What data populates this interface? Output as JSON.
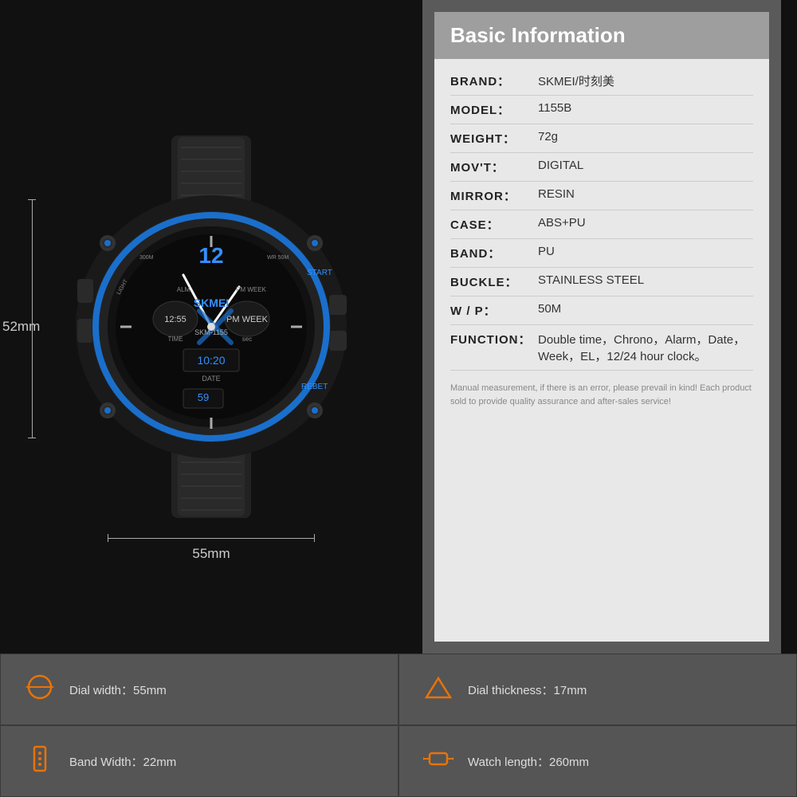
{
  "page": {
    "bg_color": "#111111"
  },
  "header": {
    "title": "Basic Information"
  },
  "specs": [
    {
      "key": "BRAND：",
      "val": "SKMEI/时刻美"
    },
    {
      "key": "MODEL：",
      "val": "1155B"
    },
    {
      "key": "WEIGHT：",
      "val": "72g"
    },
    {
      "key": "MOV'T：",
      "val": "DIGITAL"
    },
    {
      "key": "MIRROR：",
      "val": "RESIN"
    },
    {
      "key": "CASE：",
      "val": "ABS+PU"
    },
    {
      "key": "BAND：",
      "val": "PU"
    },
    {
      "key": "BUCKLE：",
      "val": "STAINLESS STEEL"
    },
    {
      "key": "W / P：",
      "val": "50M"
    },
    {
      "key": "FUNCTION：",
      "val": "Double time，Chrono，Alarm，Date，Week，EL，12/24 hour clock。"
    }
  ],
  "note": "Manual measurement, if there is an error, please prevail in kind!\nEach product sold to provide quality assurance and after-sales service!",
  "dimensions": {
    "height_label": "52mm",
    "width_label": "55mm"
  },
  "bottom_cells": [
    {
      "icon": "dial-width-icon",
      "icon_char": "⊙",
      "label": "Dial width：55mm"
    },
    {
      "icon": "dial-thickness-icon",
      "icon_char": "△",
      "label": "Dial thickness：17mm"
    },
    {
      "icon": "band-width-icon",
      "icon_char": "▣",
      "label": "Band Width：22mm"
    },
    {
      "icon": "watch-length-icon",
      "icon_char": "⊡",
      "label": "Watch length：260mm"
    }
  ]
}
